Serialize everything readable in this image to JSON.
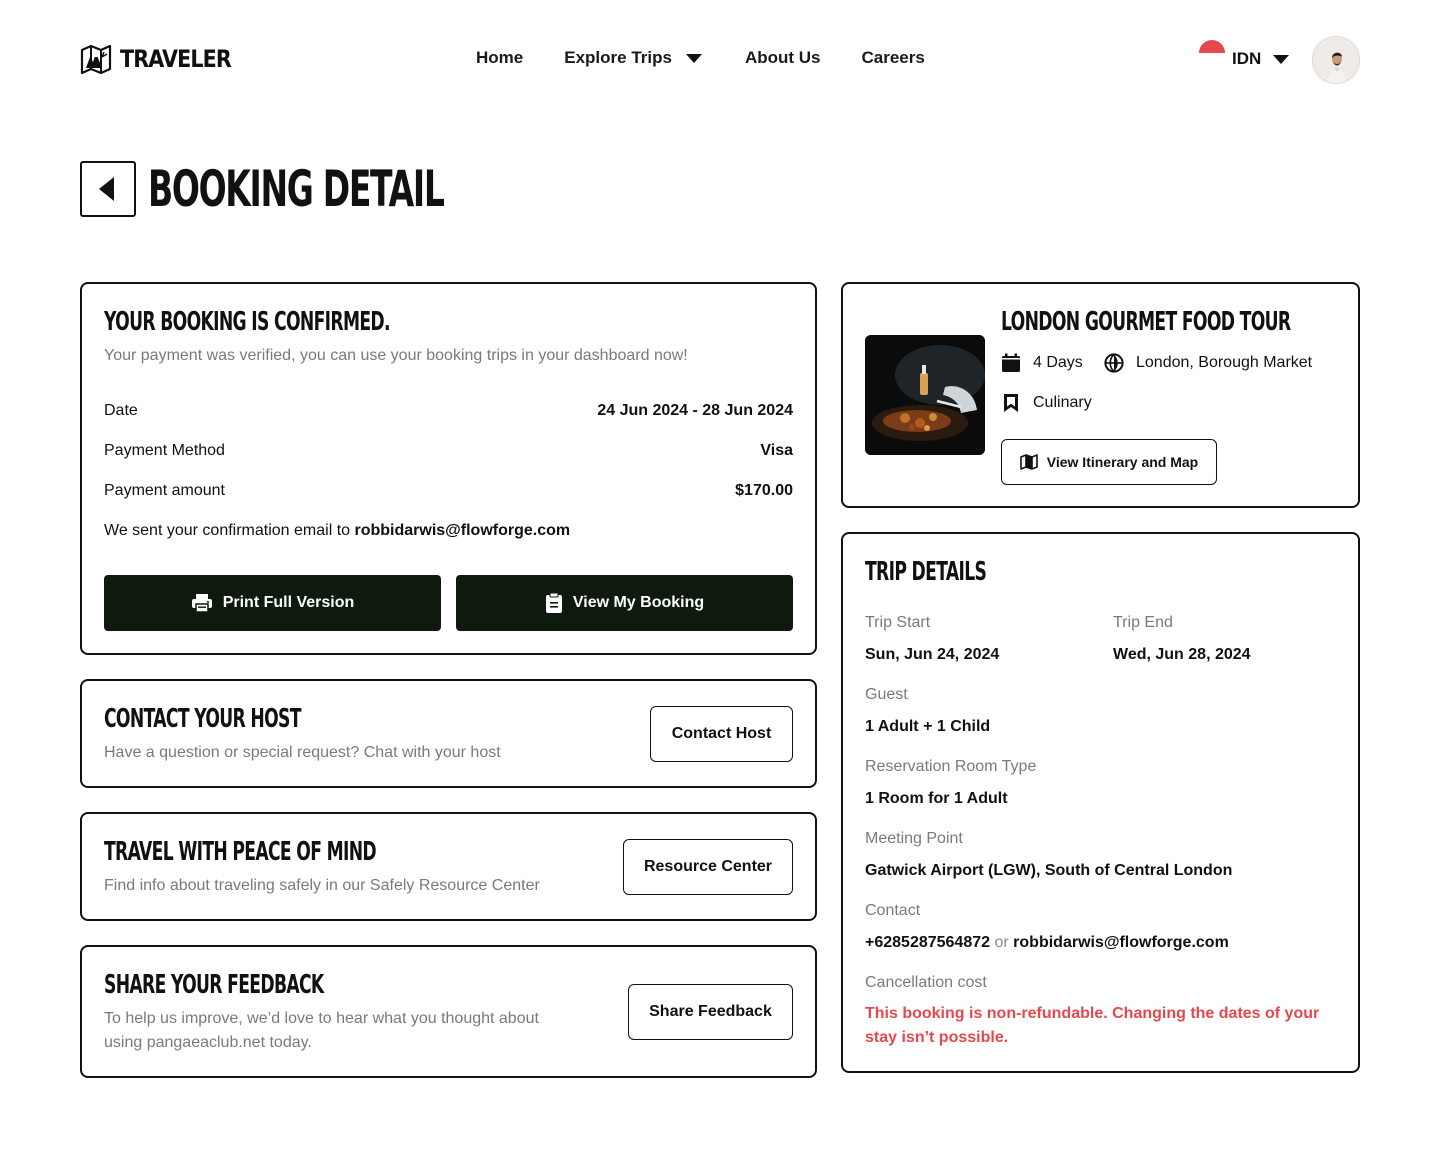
{
  "brand": {
    "name": "TRAVELER"
  },
  "nav": {
    "items": [
      {
        "label": "Home"
      },
      {
        "label": "Explore Trips"
      },
      {
        "label": "About Us"
      },
      {
        "label": "Careers"
      }
    ],
    "language": "IDN"
  },
  "page": {
    "title": "BOOKING DETAIL"
  },
  "confirmation": {
    "title": "YOUR BOOKING IS CONFIRMED.",
    "subtitle": "Your payment was verified, you can use your booking trips in your dashboard now!",
    "rows": [
      {
        "label": "Date",
        "value": "24 Jun 2024 - 28 Jun 2024"
      },
      {
        "label": "Payment Method",
        "value": "Visa"
      },
      {
        "label": "Payment amount",
        "value": "$170.00"
      }
    ],
    "email_prefix": "We sent your confirmation email to",
    "email": "robbidarwis@flowforge.com",
    "print_label": "Print Full Version",
    "view_label": "View My Booking"
  },
  "contact_host": {
    "title": "CONTACT YOUR HOST",
    "subtitle": "Have a question or special request? Chat with your host",
    "button": "Contact Host"
  },
  "peace": {
    "title": "TRAVEL WITH PEACE OF MIND",
    "subtitle": "Find info about traveling safely in our Safely Resource Center",
    "button": "Resource Center"
  },
  "feedback": {
    "title": "SHARE YOUR FEEDBACK",
    "subtitle_line1": "To help us improve, we’d love to hear what you thought about",
    "subtitle_line2": "using pangaeaclub.net today.",
    "button": "Share Feedback"
  },
  "tour": {
    "title": "LONDON GOURMET FOOD TOUR",
    "duration": "4 Days",
    "location": "London, Borough Market",
    "category": "Culinary",
    "button": "View Itinerary and Map"
  },
  "trip_details": {
    "title": "TRIP DETAILS",
    "trip_start_label": "Trip Start",
    "trip_start": "Sun, Jun 24, 2024",
    "trip_end_label": "Trip End",
    "trip_end": "Wed, Jun 28, 2024",
    "guest_label": "Guest",
    "guest": "1 Adult + 1 Child",
    "room_label": "Reservation Room Type",
    "room": "1 Room for 1 Adult",
    "meeting_label": "Meeting Point",
    "meeting": "Gatwick Airport (LGW), South of Central London",
    "contact_label": "Contact",
    "contact_phone": "+6285287564872",
    "contact_or": "or",
    "contact_email": "robbidarwis@flowforge.com",
    "cancel_label": "Cancellation cost",
    "cancel_line1": "This booking is non-refundable. Changing the dates of your",
    "cancel_line2": "stay isn’t possible."
  },
  "colors": {
    "dark_button": "#0f1a0e",
    "warning": "#e5484d",
    "muted": "#7a7a7a"
  },
  "icons": [
    "logo-icon",
    "chevron-down-icon",
    "flag-icon",
    "back-arrow-icon",
    "printer-icon",
    "clipboard-icon",
    "calendar-icon",
    "globe-icon",
    "bookmark-icon",
    "map-icon"
  ]
}
